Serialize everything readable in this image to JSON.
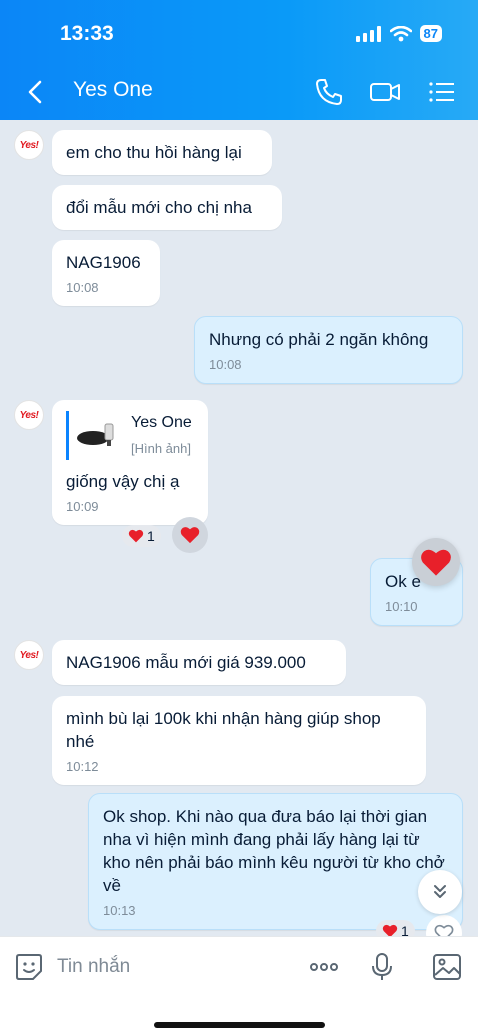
{
  "status_bar": {
    "time": "13:33",
    "battery": "87"
  },
  "header": {
    "title": "Yes One"
  },
  "avatar_text": "Yes!",
  "messages": [
    {
      "text": "em cho thu hồi hàng lại"
    },
    {
      "text": "đổi mẫu mới cho chị nha"
    },
    {
      "text": "NAG1906",
      "time": "10:08"
    },
    {
      "text": "Nhưng có phải 2 ngăn không",
      "time": "10:08"
    },
    {
      "reply_name": "Yes One",
      "reply_sub": "[Hình ảnh]",
      "text": "giống vậy chị ạ",
      "time": "10:09",
      "reaction_count": "1"
    },
    {
      "text": "Ok e",
      "time": "10:10"
    },
    {
      "text": "NAG1906  mẫu mới giá 939.000"
    },
    {
      "text": "mình bù lại 100k khi nhận hàng giúp shop nhé",
      "time": "10:12"
    },
    {
      "text": "Ok shop. Khi nào qua đưa báo lại thời gian nha vì hiện mình đang phải lấy hàng lại từ kho nên phải báo mình kêu người từ kho chở về",
      "time": "10:13",
      "reaction_count": "1"
    }
  ],
  "input": {
    "placeholder": "Tin nhắn"
  },
  "colors": {
    "header": "#0b86f7",
    "my_bubble": "#dbf0fe",
    "background": "#e2e9f1",
    "heart": "#e8202a"
  }
}
